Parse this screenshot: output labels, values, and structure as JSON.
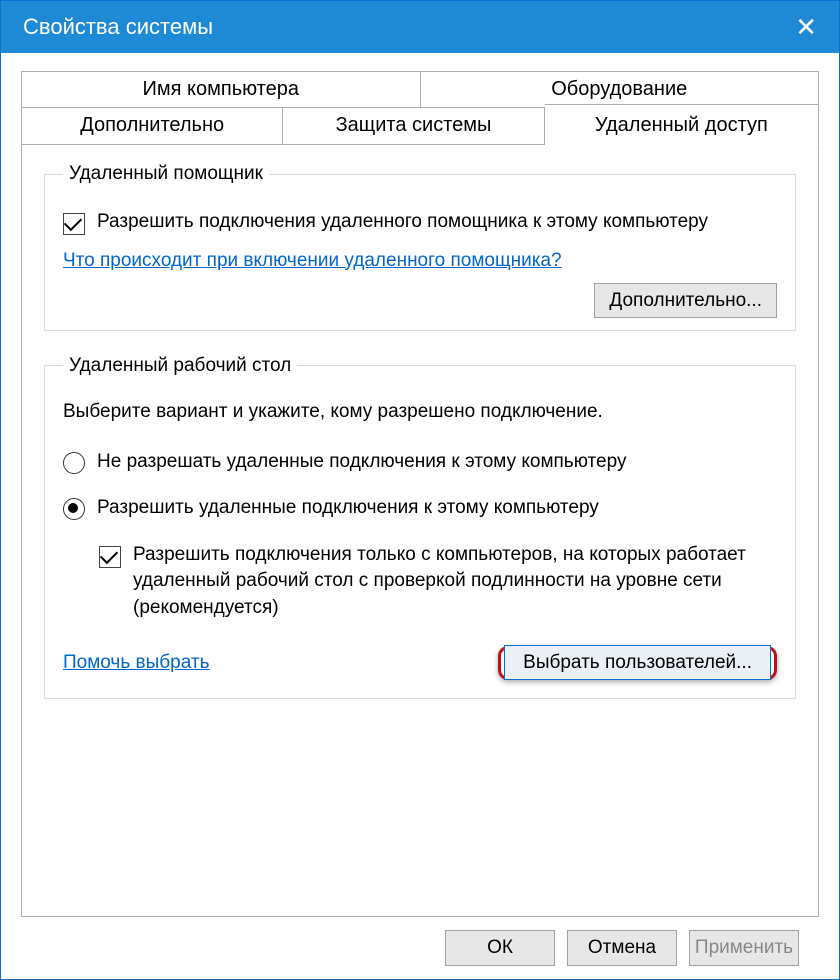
{
  "title": "Свойства системы",
  "tabs": {
    "row1": [
      "Имя компьютера",
      "Оборудование"
    ],
    "row2": [
      "Дополнительно",
      "Защита системы",
      "Удаленный доступ"
    ]
  },
  "group1": {
    "legend": "Удаленный помощник",
    "checkbox_label": "Разрешить подключения удаленного помощника к этому компьютеру",
    "checkbox_checked": true,
    "link": "Что происходит при включении удаленного помощника?",
    "advanced_btn": "Дополнительно..."
  },
  "group2": {
    "legend": "Удаленный рабочий стол",
    "instruction": "Выберите вариант и укажите, кому разрешено подключение.",
    "radio1_label": "Не разрешать удаленные подключения к этому компьютеру",
    "radio2_label": "Разрешить удаленные подключения к этому компьютеру",
    "radio_selected": 2,
    "nla_checkbox_label": "Разрешить подключения только с компьютеров, на которых работает удаленный рабочий стол с проверкой подлинности на уровне сети (рекомендуется)",
    "nla_checked": true,
    "help_link": "Помочь выбрать",
    "select_users_btn": "Выбрать пользователей..."
  },
  "footer": {
    "ok": "ОК",
    "cancel": "Отмена",
    "apply": "Применить"
  }
}
